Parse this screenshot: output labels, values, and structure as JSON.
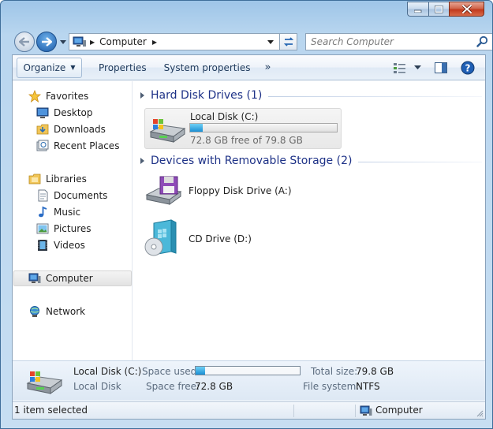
{
  "window": {
    "caption_buttons": [
      "minimize",
      "maximize",
      "close"
    ]
  },
  "address_bar": {
    "location_icon": "computer-icon",
    "location": "Computer",
    "search_placeholder": "Search Computer"
  },
  "toolbar": {
    "organize_label": "Organize",
    "properties_label": "Properties",
    "system_properties_label": "System properties",
    "more_label": "»"
  },
  "navigation": {
    "favorites": {
      "label": "Favorites",
      "items": [
        {
          "label": "Desktop",
          "icon": "desktop-icon"
        },
        {
          "label": "Downloads",
          "icon": "downloads-folder-icon"
        },
        {
          "label": "Recent Places",
          "icon": "recent-places-icon"
        }
      ]
    },
    "libraries": {
      "label": "Libraries",
      "items": [
        {
          "label": "Documents",
          "icon": "documents-icon"
        },
        {
          "label": "Music",
          "icon": "music-icon"
        },
        {
          "label": "Pictures",
          "icon": "pictures-icon"
        },
        {
          "label": "Videos",
          "icon": "videos-icon"
        }
      ]
    },
    "computer": {
      "label": "Computer",
      "selected": true
    },
    "network": {
      "label": "Network"
    }
  },
  "content": {
    "groups": {
      "hard_disk": {
        "title": "Hard Disk Drives (1)"
      },
      "removable": {
        "title": "Devices with Removable Storage (2)"
      }
    },
    "local_disk": {
      "name": "Local Disk (C:)",
      "free_text": "72.8 GB free of 79.8 GB",
      "used_fraction": 0.088
    },
    "removable_devices": [
      {
        "name": "Floppy Disk Drive (A:)",
        "icon": "floppy-drive-icon"
      },
      {
        "name": "CD Drive (D:)",
        "icon": "cd-drive-icon"
      }
    ]
  },
  "details_pane": {
    "name": "Local Disk (C:)",
    "type": "Local Disk",
    "space_used_label": "Space used:",
    "space_free_label": "Space free:",
    "space_free_value": "72.8 GB",
    "total_size_label": "Total size:",
    "total_size_value": "79.8 GB",
    "file_system_label": "File system:",
    "file_system_value": "NTFS",
    "used_fraction": 0.088
  },
  "status_bar": {
    "selection_text": "1 item selected",
    "location_label": "Computer"
  }
}
